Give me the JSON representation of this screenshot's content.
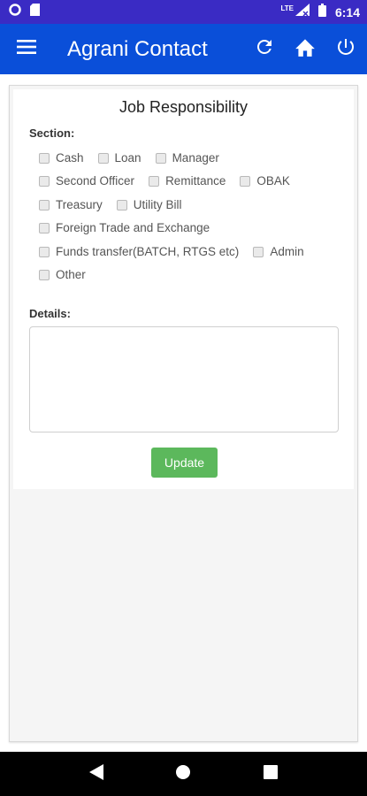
{
  "status_bar": {
    "time": "6:14",
    "network": "LTE"
  },
  "app_bar": {
    "title": "Agrani Contact"
  },
  "card": {
    "title": "Job Responsibility",
    "section_label": "Section:",
    "options": [
      {
        "label": "Cash",
        "checked": false
      },
      {
        "label": "Loan",
        "checked": false
      },
      {
        "label": "Manager",
        "checked": false
      },
      {
        "label": "Second Officer",
        "checked": false
      },
      {
        "label": "Remittance",
        "checked": false
      },
      {
        "label": "OBAK",
        "checked": false
      },
      {
        "label": "Treasury",
        "checked": false
      },
      {
        "label": "Utility Bill",
        "checked": false
      },
      {
        "label": "Foreign Trade and Exchange",
        "checked": false
      },
      {
        "label": "Funds transfer(BATCH, RTGS etc)",
        "checked": false
      },
      {
        "label": "Admin",
        "checked": false
      },
      {
        "label": "Other",
        "checked": false
      }
    ],
    "details_label": "Details:",
    "details_value": "",
    "update_label": "Update"
  },
  "colors": {
    "status_bar": "#3a2bc4",
    "app_bar": "#0a4fd9",
    "update_button": "#5cb85c"
  },
  "icons": {
    "menu": "hamburger-menu-icon",
    "refresh": "refresh-icon",
    "home": "home-icon",
    "power": "power-icon"
  }
}
